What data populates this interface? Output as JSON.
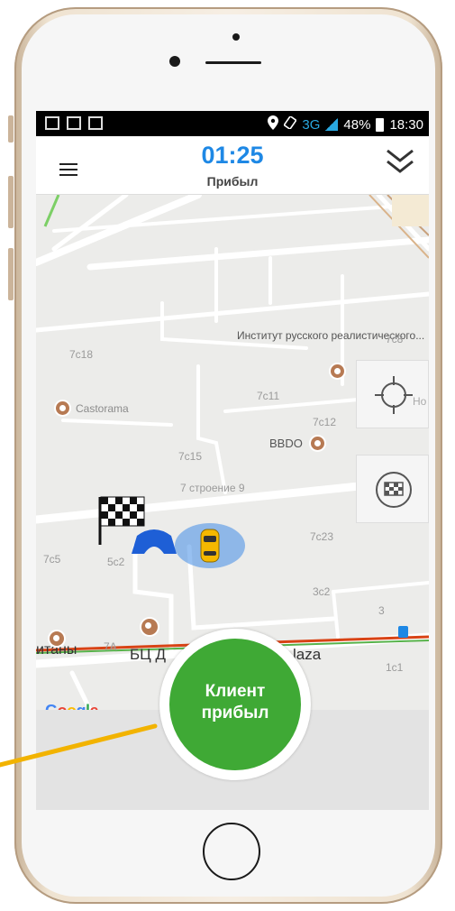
{
  "status_bar": {
    "network": "3G",
    "battery": "48%",
    "time": "18:30"
  },
  "header": {
    "timer": "01:25",
    "status": "Прибыл"
  },
  "map": {
    "labels": {
      "institute": "Институт русского реалистического...",
      "castorama": "Castorama",
      "bbdo": "BBDO",
      "building9": "7 строение 9",
      "bc_left": "БЦ Д",
      "plaza": "laza",
      "cut_left": "итаны",
      "cut_right": "Но",
      "b7c18": "7с18",
      "b7c8": "7с8",
      "b7c11": "7с11",
      "b7c12": "7с12",
      "b7c15": "7с15",
      "b7c23": "7с23",
      "b7c5": "7с5",
      "b5c2": "5с2",
      "b3c2": "3с2",
      "b3": "3",
      "b7a": "7А",
      "b1c1": "1с1"
    },
    "google": "Google"
  },
  "cta": {
    "line1": "Клиент",
    "line2": "прибыл"
  },
  "colors": {
    "accent_blue": "#1e88e5",
    "cta_green": "#3fa935",
    "pointer_yellow": "#f2b300"
  },
  "icons": {
    "menu": "menu-icon",
    "collapse": "double-chevron-down-icon",
    "locate": "crosshair-icon",
    "finish": "finish-flag-icon"
  }
}
